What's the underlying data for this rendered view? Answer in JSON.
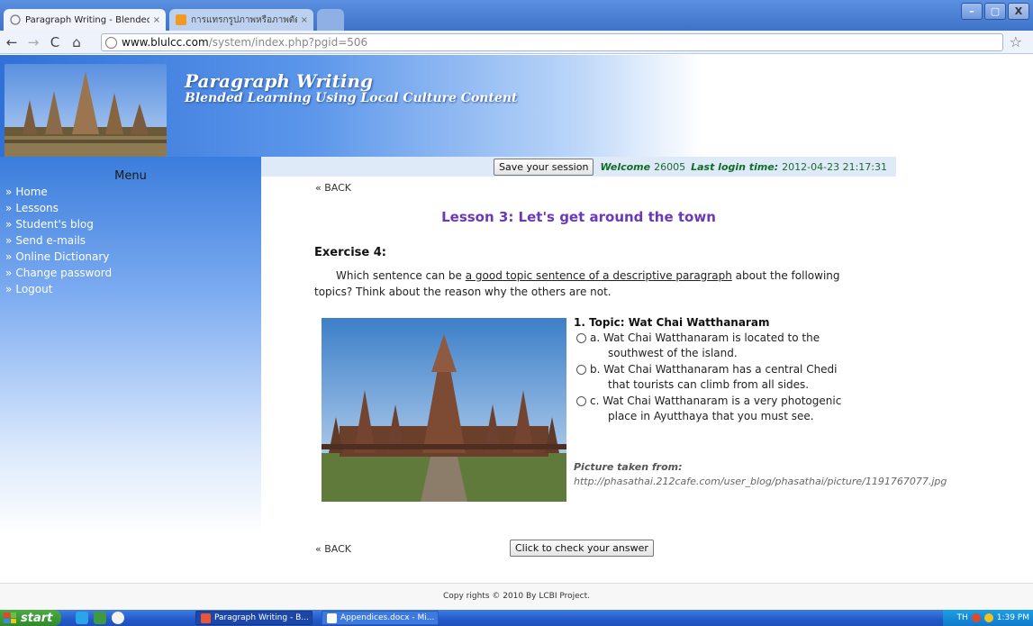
{
  "browser": {
    "tabs": [
      {
        "title": "Paragraph Writing - Blended Le",
        "close": "×"
      },
      {
        "title": "การแทรกรูปภาพหรือภาพตัดปะ - ",
        "close": "×"
      }
    ],
    "window_buttons": {
      "minimize": "–",
      "maximize": "▢",
      "close": "X"
    },
    "address": {
      "host": "www.blulcc.com",
      "path": "/system/index.php?pgid=506"
    },
    "icons": [
      "back-arrow-icon",
      "forward-arrow-icon",
      "reload-icon",
      "home-icon",
      "globe-icon",
      "bookmark-star-icon"
    ]
  },
  "banner": {
    "title": "Paragraph Writing",
    "subtitle": "Blended Learning Using Local Culture Content"
  },
  "sidebar": {
    "heading": "Menu",
    "items": [
      {
        "label": "Home"
      },
      {
        "label": "Lessons"
      },
      {
        "label": "Student's blog"
      },
      {
        "label": "Send e-mails"
      },
      {
        "label": "Online Dictionary"
      },
      {
        "label": "Change password"
      },
      {
        "label": "Logout"
      }
    ],
    "bullet": "»"
  },
  "session": {
    "save_button": "Save your session",
    "welcome_label": "Welcome",
    "user_id": "26005",
    "last_login_label": "Last login time:",
    "last_login_value": "2012-04-23 21:17:31"
  },
  "content": {
    "back_top": "« BACK",
    "lesson_title": "Lesson 3: Let's get around the town",
    "exercise_title": "Exercise 4:",
    "instruction_pre": "Which sentence can be ",
    "instruction_link": "a good topic sentence of a descriptive paragraph",
    "instruction_post": " about the following topics? Think about the reason why the others are not.",
    "question": {
      "topic": "1. Topic: Wat Chai Watthanaram",
      "options": [
        "a. Wat Chai Watthanaram is located to the southwest of the island.",
        "b. Wat Chai Watthanaram has a central Chedi that tourists can climb from all sides.",
        "c. Wat Chai Watthanaram is a very photogenic place in Ayutthaya that you must see."
      ]
    },
    "credit_label": "Picture taken from:",
    "credit_url": "http://phasathai.212cafe.com/user_blog/phasathai/picture/1191767077.jpg",
    "back_bottom": "« BACK",
    "check_button": "Click to check your answer"
  },
  "footer": {
    "text": "Copy rights © 2010 By LCBI Project."
  },
  "taskbar": {
    "start_label": "start",
    "tasks": [
      {
        "label": "Paragraph Writing - B..."
      },
      {
        "label": "Appendices.docx - Mi..."
      }
    ],
    "tray_lang": "TH",
    "clock": "1:39 PM"
  },
  "colors": {
    "banner_blue": "#2f71d8",
    "lesson_title_purple": "#6a39b8",
    "session_green": "#0f6d24",
    "taskbar_blue": "#2359c8",
    "start_green": "#3c9a38"
  }
}
